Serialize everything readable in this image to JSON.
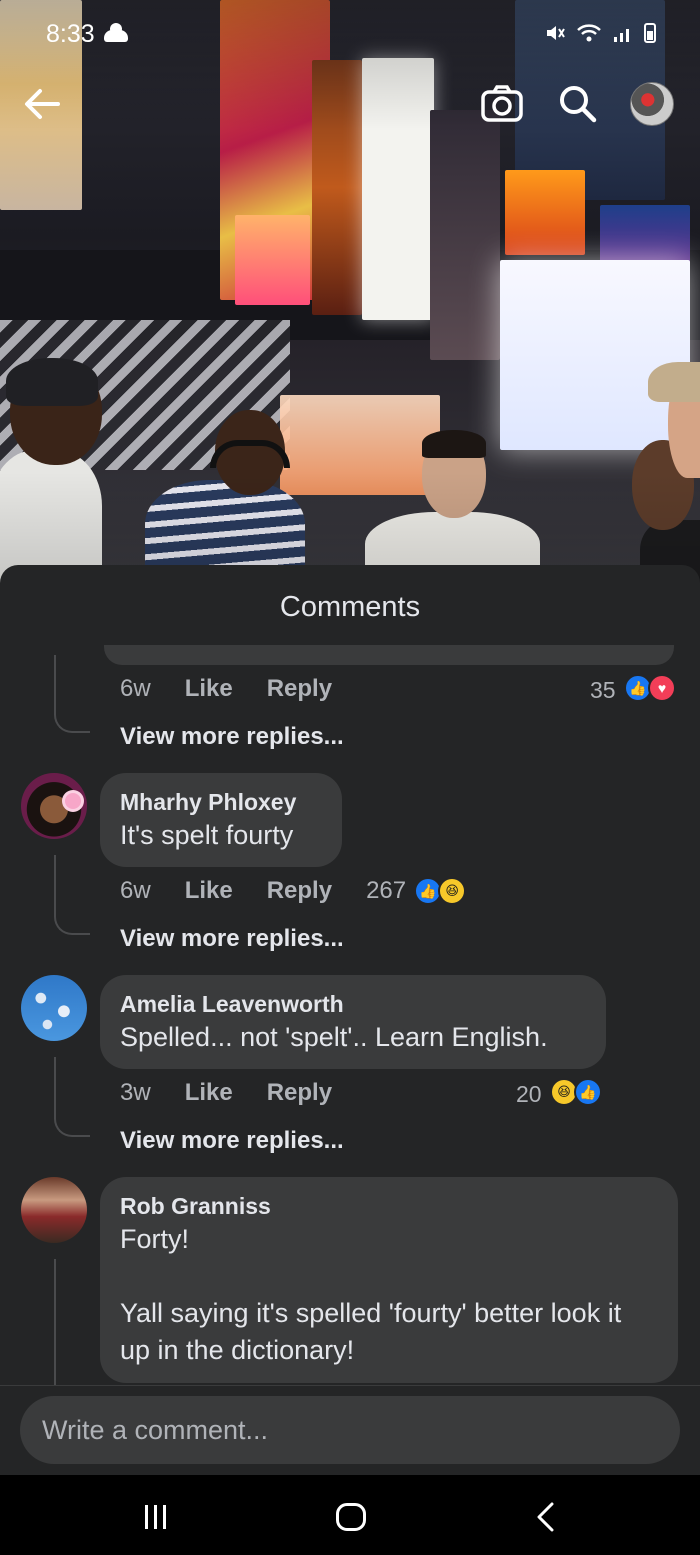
{
  "status_bar": {
    "time": "8:33",
    "icons": [
      "cloud-icon",
      "mute-icon",
      "wifi-icon",
      "signal-icon",
      "battery-icon"
    ]
  },
  "top_bar": {
    "icons": [
      "back-arrow-icon",
      "camera-icon",
      "search-icon",
      "profile-avatar"
    ]
  },
  "sheet": {
    "title": "Comments"
  },
  "previous_comment": {
    "time": "6w",
    "like_label": "Like",
    "reply_label": "Reply",
    "reaction_count": "35",
    "reactions": [
      "like",
      "love"
    ],
    "view_more": "View more replies..."
  },
  "comments": [
    {
      "name": "Mharhy Phloxey",
      "text": "It's spelt fourty",
      "time": "6w",
      "like_label": "Like",
      "reply_label": "Reply",
      "reaction_count": "267",
      "reactions": [
        "like",
        "haha"
      ],
      "view_more": "View more replies..."
    },
    {
      "name": "Amelia Leavenworth",
      "text": "Spelled... not 'spelt'.. Learn English.",
      "time": "3w",
      "like_label": "Like",
      "reply_label": "Reply",
      "reaction_count": "20",
      "reactions": [
        "haha",
        "like"
      ],
      "view_more": "View more replies..."
    },
    {
      "name": "Rob Granniss",
      "text": "Forty!\n\nYall saying it's spelled 'fourty' better look it up in the dictionary!"
    }
  ],
  "composer": {
    "placeholder": "Write a comment..."
  },
  "nav_bar": {
    "icons": [
      "recent-apps-icon",
      "home-icon",
      "back-icon"
    ]
  },
  "colors": {
    "sheet_bg": "#242526",
    "bubble_bg": "#3a3b3c",
    "like_blue": "#1877f2",
    "love_red": "#f33e58",
    "haha_yellow": "#f7c82a",
    "secondary_text": "#b0b3b8"
  }
}
